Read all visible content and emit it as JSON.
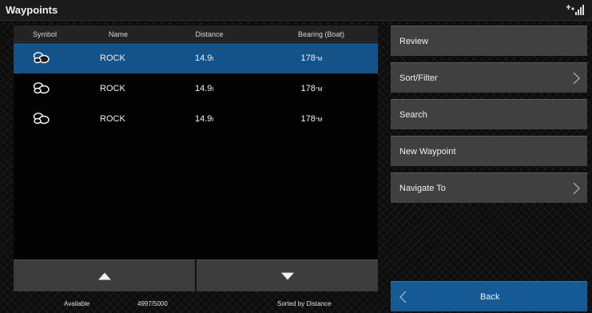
{
  "title": "Waypoints",
  "icons": {
    "status": "signal-strength-icon",
    "waypoint_symbol": "rock-icon",
    "scroll_up": "triangle-up-icon",
    "scroll_down": "triangle-down-icon",
    "chevron_right": "chevron-right-icon",
    "chevron_left": "chevron-left-icon"
  },
  "table": {
    "headers": {
      "symbol": "Symbol",
      "name": "Name",
      "distance": "Distance",
      "bearing": "Bearing (Boat)"
    },
    "rows": [
      {
        "name": "ROCK",
        "distance": "14.9",
        "distance_unit": "Ⅰ",
        "bearing": "178",
        "bearing_unit": "°M",
        "selected": true
      },
      {
        "name": "ROCK",
        "distance": "14.9",
        "distance_unit": "Ⅰ",
        "bearing": "178",
        "bearing_unit": "°M",
        "selected": false
      },
      {
        "name": "ROCK",
        "distance": "14.9",
        "distance_unit": "Ⅰ",
        "bearing": "178",
        "bearing_unit": "°M",
        "selected": false
      }
    ]
  },
  "status": {
    "available_label": "Available",
    "available_value": "4997/5000",
    "sort": "Sorted by Distance"
  },
  "menu": {
    "review": "Review",
    "sort_filter": "Sort/Filter",
    "search": "Search",
    "new_waypoint": "New Waypoint",
    "navigate_to": "Navigate To",
    "back": "Back"
  },
  "colors": {
    "selected_row": "#14528a",
    "back_button": "#165a95",
    "menu_button": "#404040"
  }
}
